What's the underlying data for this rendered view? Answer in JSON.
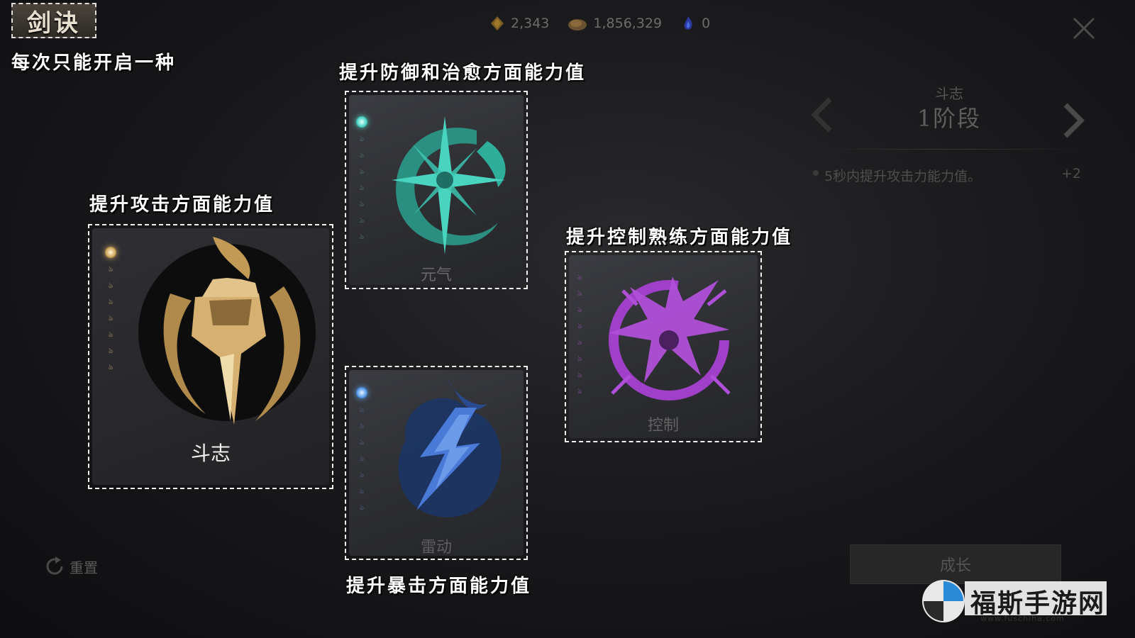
{
  "header": {
    "title": "剑诀",
    "currencies": [
      {
        "icon": "gem-shard-icon",
        "value": "2,343",
        "color": "#a07a2a"
      },
      {
        "icon": "coin-pouch-icon",
        "value": "1,856,329",
        "color": "#8a6a3a"
      },
      {
        "icon": "blue-flame-icon",
        "value": "0",
        "color": "#3a4fc0"
      }
    ]
  },
  "annotations": {
    "one_at_a_time": "每次只能开启一种",
    "defense": "提升防御和治愈方面能力值",
    "attack": "提升攻击方面能力值",
    "control": "提升控制熟练方面能力值",
    "crit": "提升暴击方面能力值"
  },
  "cards": {
    "douzhi": {
      "label": "斗志",
      "icon": "fist-emblem-icon",
      "color": "#d0a860"
    },
    "yuanqi": {
      "label": "元气",
      "icon": "teal-swirl-icon",
      "color": "#3fc7b0"
    },
    "leidong": {
      "label": "雷动",
      "icon": "lightning-emblem-icon",
      "color": "#4a78d8"
    },
    "kongzhi": {
      "label": "控制",
      "icon": "thorn-ring-icon",
      "color": "#b04fd0"
    }
  },
  "panel": {
    "name": "斗志",
    "stage": "1阶段",
    "effect": "5秒内提升攻击力能力值。",
    "effect_value": "+2",
    "grow_button": "成长"
  },
  "reset_label": "重置",
  "watermark": {
    "text": "福斯手游网",
    "url": "www.fuschiha.com"
  }
}
